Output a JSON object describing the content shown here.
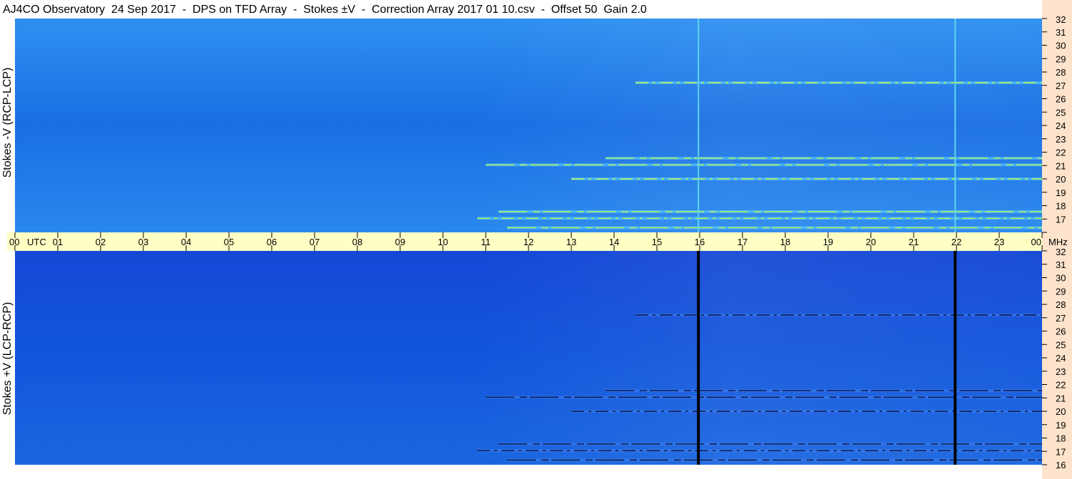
{
  "title": "AJ4CO Observatory  24 Sep 2017  -  DPS on TFD Array  -  Stokes ±V  -  Correction Array 2017 01 10.csv  -  Offset 50  Gain 2.0",
  "panels": {
    "top_label": "Stokes -V (RCP-LCP)",
    "bottom_label": "Stokes +V (LCP-RCP)"
  },
  "colors": {
    "top_background": "#1a73e6",
    "bottom_background": "#0f4bd4",
    "emission_bright": "#c8ff3c",
    "emission_dark": "#050a30",
    "time_band": "#ffffc4",
    "freq_band": "#fde3cb"
  },
  "chart_data": {
    "type": "heatmap",
    "title": "AJ4CO Observatory  24 Sep 2017  -  DPS on TFD Array  -  Stokes ±V  -  Correction Array 2017 01 10.csv  -  Offset 50  Gain 2.0",
    "x_axis": {
      "unit_label": "UTC",
      "ticks": [
        "00",
        "01",
        "02",
        "03",
        "04",
        "05",
        "06",
        "07",
        "08",
        "09",
        "10",
        "11",
        "12",
        "13",
        "14",
        "15",
        "16",
        "17",
        "18",
        "19",
        "20",
        "21",
        "22",
        "23",
        "00"
      ],
      "range_hours": [
        0,
        24
      ]
    },
    "y_axis": {
      "unit_label": "MHz",
      "ticks": [
        "16",
        "17",
        "18",
        "19",
        "20",
        "21",
        "22",
        "23",
        "24",
        "25",
        "26",
        "27",
        "28",
        "29",
        "30",
        "31",
        "32"
      ],
      "range_mhz": [
        16,
        32
      ]
    },
    "panels": [
      "Stokes -V (RCP-LCP)",
      "Stokes +V (LCP-RCP)"
    ],
    "interference_lines_utc": [
      15.97,
      21.97
    ],
    "emission_bands": [
      {
        "freq_mhz": 21.05,
        "start_utc": 11.0,
        "end_utc": 24.0
      },
      {
        "freq_mhz": 17.05,
        "start_utc": 10.8,
        "end_utc": 24.0
      },
      {
        "freq_mhz": 17.55,
        "start_utc": 11.3,
        "end_utc": 24.0
      },
      {
        "freq_mhz": 20.0,
        "start_utc": 13.0,
        "end_utc": 24.0
      },
      {
        "freq_mhz": 21.55,
        "start_utc": 13.8,
        "end_utc": 24.0
      },
      {
        "freq_mhz": 27.2,
        "start_utc": 14.5,
        "end_utc": 24.0
      },
      {
        "freq_mhz": 16.35,
        "start_utc": 11.5,
        "end_utc": 24.0
      }
    ]
  }
}
